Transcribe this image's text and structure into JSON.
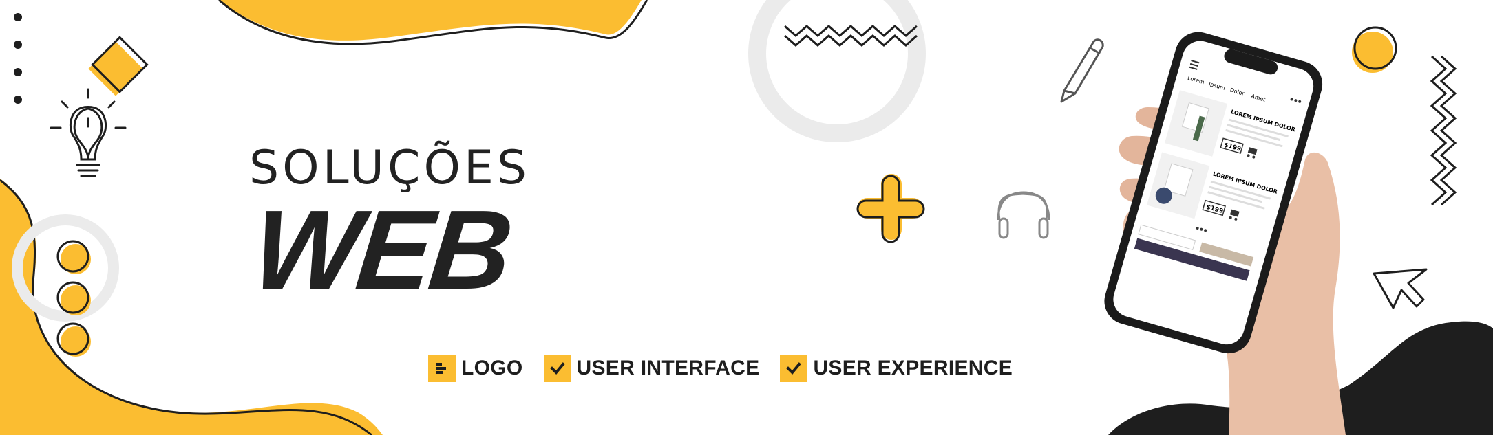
{
  "banner": {
    "headline_sub": "SOLUÇÕES",
    "headline_main": "WEB"
  },
  "features": [
    {
      "label": "LOGO",
      "icon": "logo-bars-icon"
    },
    {
      "label": "USER INTERFACE",
      "icon": "check-icon"
    },
    {
      "label": "USER EXPERIENCE",
      "icon": "check-icon"
    }
  ],
  "phone": {
    "nav": [
      "Lorem",
      "Ipsum",
      "Dolor",
      "Amet"
    ],
    "products": [
      {
        "title": "LOREM IPSUM DOLOR",
        "price": "$199"
      },
      {
        "title": "LOREM IPSUM DOLOR",
        "price": "$199"
      }
    ]
  },
  "decorations": [
    "lightbulb-icon",
    "pencil-icon",
    "headphones-icon",
    "cursor-arrow-icon",
    "plus-icon",
    "zigzag-icon",
    "diamond-icon",
    "dots-icon"
  ],
  "colors": {
    "accent": "#fbbd31",
    "dark": "#1e1e1e",
    "light_gray": "#ebebeb"
  }
}
